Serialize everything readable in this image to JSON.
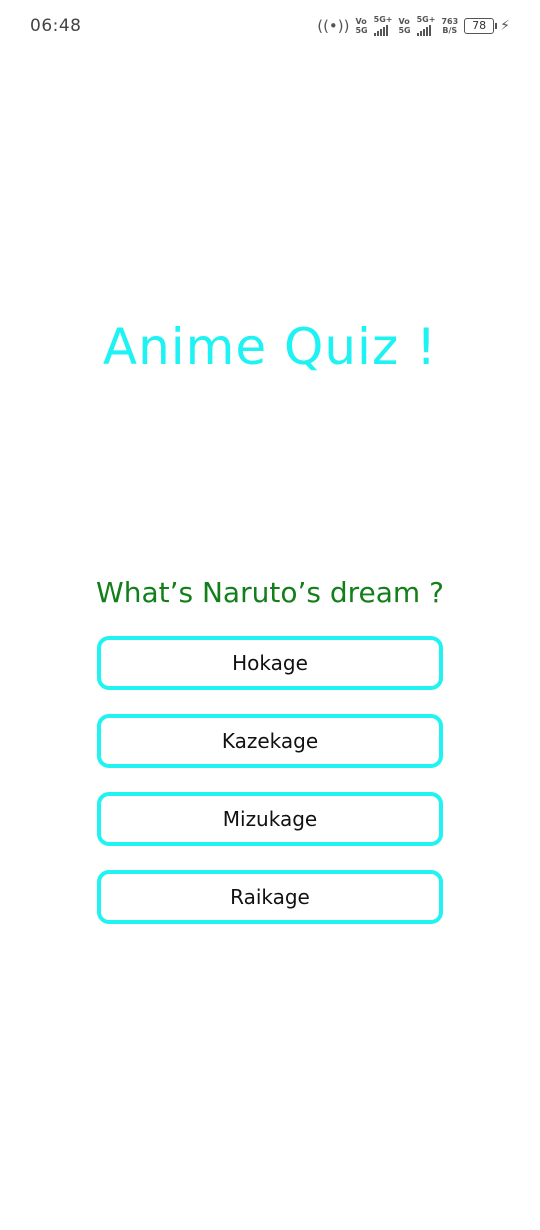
{
  "status_bar": {
    "time": "06:48",
    "sim1_top": "Vo",
    "sim1_bottom": "5G",
    "sim1_type": "5G+",
    "sim2_top": "Vo",
    "sim2_bottom": "5G",
    "sim2_type": "5G+",
    "speed_value": "763",
    "speed_unit": "B/S",
    "battery": "78",
    "icons": [
      "hotspot-icon",
      "signal-icon",
      "charging-icon"
    ]
  },
  "app": {
    "title": "Anime Quiz !",
    "question": "What’s Naruto’s dream ?",
    "options": [
      "Hokage",
      "Kazekage",
      "Mizukage",
      "Raikage"
    ]
  },
  "colors": {
    "title": "#1ff2f2",
    "question": "#137f1a",
    "option_border": "#21f2f2"
  }
}
